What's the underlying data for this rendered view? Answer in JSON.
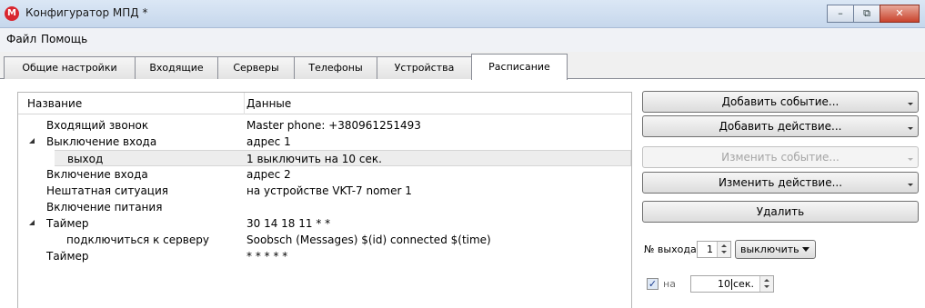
{
  "window": {
    "title": "Конфигуратор МПД *",
    "logo_text": "М",
    "minimize_glyph": "–",
    "maximize_glyph": "⧉",
    "close_glyph": "✕"
  },
  "menu": [
    "Файл",
    "Помощь"
  ],
  "tabs": [
    {
      "label": "Общие настройки",
      "active": false
    },
    {
      "label": "Входящие",
      "active": false
    },
    {
      "label": "Серверы",
      "active": false
    },
    {
      "label": "Телефоны",
      "active": false
    },
    {
      "label": "Устройства",
      "active": false
    },
    {
      "label": "Расписание",
      "active": true
    }
  ],
  "schedule": {
    "columns": [
      "Название",
      "Данные"
    ],
    "rows": [
      {
        "name": "Входящий звонок",
        "data": "Master phone: +380961251493",
        "expanded": null
      },
      {
        "name": "Выключение входа",
        "data": "адрес 1",
        "expanded": true
      },
      {
        "name": "выход",
        "data": "1 выключить на 10 сек.",
        "expanded": null
      },
      {
        "name": "Включение входа",
        "data": "адрес 2",
        "expanded": null
      },
      {
        "name": "Нештатная ситуация",
        "data": "на устройстве VKT-7 nomer 1",
        "expanded": null
      },
      {
        "name": "Включение питания",
        "data": "",
        "expanded": null
      },
      {
        "name": "Таймер",
        "data": "30 14 18 11 * *",
        "expanded": true
      },
      {
        "name": "подключиться к серверу",
        "data": "Soobsch (Messages) $(id) connected $(time)",
        "expanded": null
      },
      {
        "name": "Таймер",
        "data": "* * * * *",
        "expanded": null
      }
    ]
  },
  "actions": {
    "add_event": "Добавить событие...",
    "add_action": "Добавить действие...",
    "edit_event": "Изменить событие...",
    "edit_action": "Изменить действие...",
    "delete": "Удалить"
  },
  "output": {
    "label": "№ выхода",
    "number": "1",
    "mode": "выключить",
    "duration_checked": true,
    "duration_prefix": "на",
    "duration_value": "10",
    "duration_unit": "сек."
  }
}
